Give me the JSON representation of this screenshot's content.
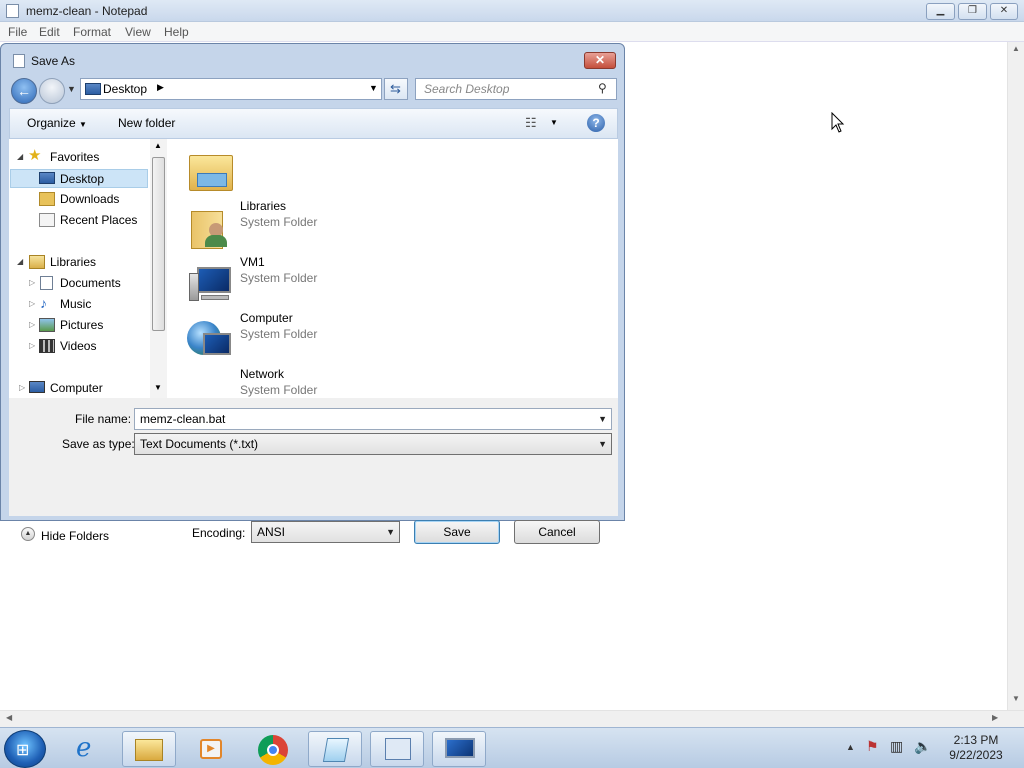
{
  "window": {
    "title": "memz-clean - Notepad"
  },
  "menu": [
    "File",
    "Edit",
    "Format",
    "View",
    "Help"
  ],
  "dialog": {
    "title": "Save As",
    "address_location": "Desktop",
    "search_placeholder": "Search Desktop",
    "toolbar": {
      "organize": "Organize",
      "new_folder": "New folder"
    },
    "nav": {
      "favorites": "Favorites",
      "desktop": "Desktop",
      "downloads": "Downloads",
      "recent": "Recent Places",
      "libraries": "Libraries",
      "documents": "Documents",
      "music": "Music",
      "pictures": "Pictures",
      "videos": "Videos",
      "computer": "Computer"
    },
    "items": [
      {
        "name": "Libraries",
        "type": "System Folder",
        "icon": "libraries-folder-icon"
      },
      {
        "name": "VM1",
        "type": "System Folder",
        "icon": "user-folder-icon"
      },
      {
        "name": "Computer",
        "type": "System Folder",
        "icon": "computer-icon"
      },
      {
        "name": "Network",
        "type": "System Folder",
        "icon": "network-globe-icon"
      }
    ],
    "file_name_label": "File name:",
    "file_name": "memz-clean.bat",
    "save_type_label": "Save as type:",
    "save_type": "Text Documents (*.txt)",
    "hide_folders": "Hide Folders",
    "encoding_label": "Encoding:",
    "encoding": "ANSI",
    "save": "Save",
    "cancel": "Cancel"
  },
  "taskbar": {
    "time": "2:13 PM",
    "date": "9/22/2023"
  }
}
